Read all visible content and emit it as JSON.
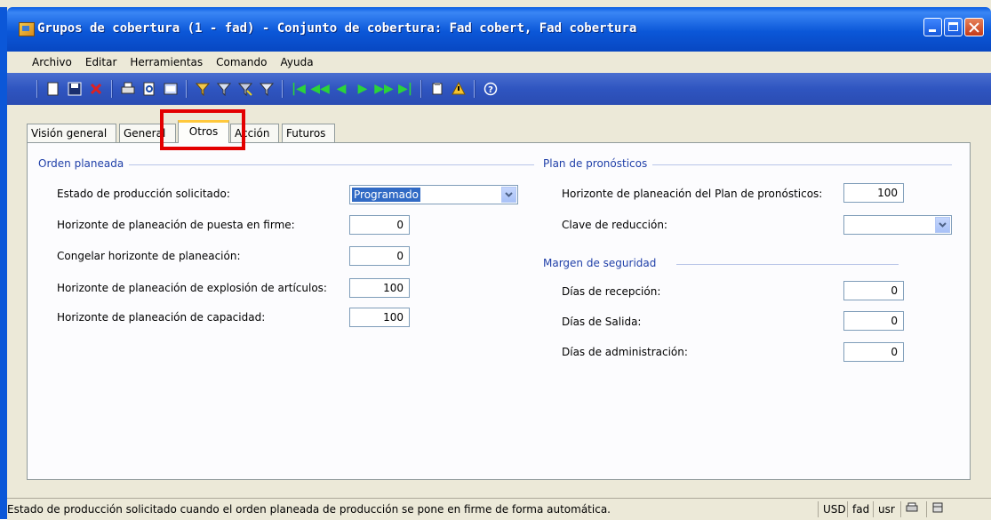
{
  "window": {
    "title": "Grupos de cobertura (1 - fad) - Conjunto de cobertura: Fad cobert, Fad cobertura"
  },
  "menu": {
    "items": [
      "Archivo",
      "Editar",
      "Herramientas",
      "Comando",
      "Ayuda"
    ]
  },
  "tabs": {
    "items": [
      "Visión general",
      "General",
      "Otros",
      "Acción",
      "Futuros"
    ],
    "active": "Otros"
  },
  "orden_planeada": {
    "title": "Orden planeada",
    "estado_label": "Estado de producción solicitado:",
    "estado_value": "Programado",
    "firme_label": "Horizonte de planeación de puesta en firme:",
    "firme_value": "0",
    "congelar_label": "Congelar horizonte de planeación:",
    "congelar_value": "0",
    "explosion_label": "Horizonte de planeación de explosión de artículos:",
    "explosion_value": "100",
    "capacidad_label": "Horizonte de planeación de capacidad:",
    "capacidad_value": "100"
  },
  "plan_pronosticos": {
    "title": "Plan de pronósticos",
    "horizonte_label": "Horizonte de planeación del Plan de pronósticos:",
    "horizonte_value": "100",
    "clave_label": "Clave de reducción:",
    "clave_value": ""
  },
  "margen_seguridad": {
    "title": "Margen de seguridad",
    "recepcion_label": "Días de recepción:",
    "recepcion_value": "0",
    "salida_label": "Días de Salida:",
    "salida_value": "0",
    "administracion_label": "Días de administración:",
    "administracion_value": "0"
  },
  "status": {
    "text": "Estado de producción solicitado cuando el orden planeada de producción se pone en firme de forma automática.",
    "currency": "USD",
    "company": "fad",
    "user": "usr"
  },
  "colors": {
    "titlebar": "#0b57d8",
    "toolbar": "#2f55c0",
    "group_title": "#1f3fa8",
    "highlight": "#e30000",
    "selection": "#316ac5"
  }
}
